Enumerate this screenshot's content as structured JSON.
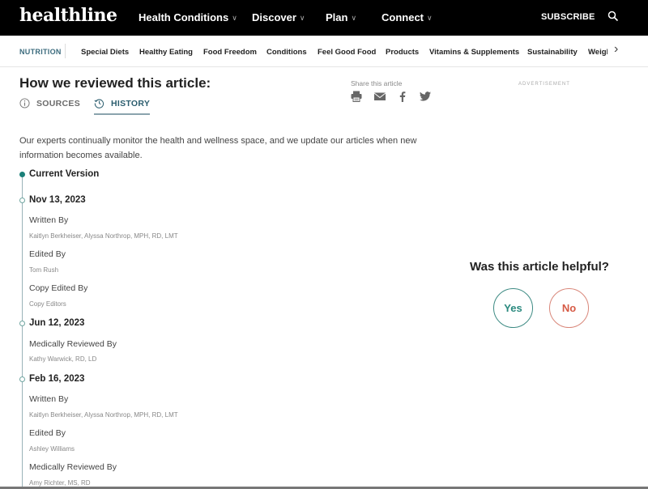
{
  "header": {
    "logo": "healthline",
    "nav": [
      {
        "label": "Health Conditions"
      },
      {
        "label": "Discover"
      },
      {
        "label": "Plan"
      },
      {
        "label": "Connect"
      }
    ],
    "subscribe_label": "SUBSCRIBE",
    "search_icon": "search-icon"
  },
  "subnav": {
    "category": "NUTRITION",
    "items": [
      "Special Diets",
      "Healthy Eating",
      "Food Freedom",
      "Conditions",
      "Feel Good Food",
      "Products",
      "Vitamins & Supplements",
      "Sustainability",
      "Weight Management"
    ],
    "next_icon": "chevron-right-icon"
  },
  "review": {
    "title": "How we reviewed this article:",
    "tabs": [
      {
        "label": "SOURCES",
        "icon": "info-icon",
        "active": false
      },
      {
        "label": "HISTORY",
        "icon": "history-icon",
        "active": true
      }
    ],
    "intro": "Our experts continually monitor the health and wellness space, and we update our articles when new information becomes available.",
    "current_version_label": "Current Version",
    "history": [
      {
        "date": "Nov 13, 2023",
        "entries": [
          {
            "role": "Written By",
            "name": "Kaitlyn Berkheiser, Alyssa Northrop, MPH, RD, LMT"
          },
          {
            "role": "Edited By",
            "name": "Tom Rush"
          },
          {
            "role": "Copy Edited By",
            "name": "Copy Editors"
          }
        ]
      },
      {
        "date": "Jun 12, 2023",
        "entries": [
          {
            "role": "Medically Reviewed By",
            "name": "Kathy Warwick, RD, LD"
          }
        ]
      },
      {
        "date": "Feb 16, 2023",
        "entries": [
          {
            "role": "Written By",
            "name": "Kaitlyn Berkheiser, Alyssa Northrop, MPH, RD, LMT"
          },
          {
            "role": "Edited By",
            "name": "Ashley Williams"
          },
          {
            "role": "Medically Reviewed By",
            "name": "Amy Richter, MS, RD"
          }
        ]
      }
    ]
  },
  "share": {
    "label": "Share this article",
    "icons": [
      "print-icon",
      "email-icon",
      "facebook-icon",
      "twitter-icon"
    ]
  },
  "advertisement_label": "ADVERTISEMENT",
  "feedback": {
    "question": "Was this article helpful?",
    "yes_label": "Yes",
    "no_label": "No"
  },
  "colors": {
    "accent_teal": "#1b8079",
    "no_red": "#d65a45",
    "nav_bg": "#000000"
  }
}
